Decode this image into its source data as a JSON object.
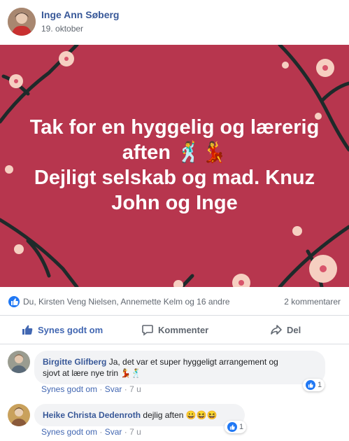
{
  "post": {
    "author": "Inge Ann Søberg",
    "date": "19. oktober",
    "banner_text_lines": [
      "Tak for en hyggelig og lærerig",
      "aften 🕺💃",
      "Dejligt selskab og mad. Knuz",
      "John og Inge"
    ],
    "banner_color": "#b7364e"
  },
  "stats": {
    "reactions_text": "Du, Kirsten Veng Nielsen, Annemette Kelm og 16 andre",
    "comments_text": "2 kommentarer"
  },
  "actions": {
    "like": "Synes godt om",
    "comment": "Kommenter",
    "share": "Del"
  },
  "comments": [
    {
      "name": "Birgitte Glifberg",
      "text": "Ja, det var et super hyggeligt arrangement og",
      "text2": "sjovt at lære nye trin 💃🕺",
      "like_label": "Synes godt om",
      "reply_label": "Svar",
      "age": "7 u",
      "likes": "1"
    },
    {
      "name": "Heike Christa Dedenroth",
      "text": "dejlig aften 😀😆😆",
      "like_label": "Synes godt om",
      "reply_label": "Svar",
      "age": "7 u",
      "likes": "1"
    }
  ],
  "colors": {
    "accent": "#4267b2",
    "name_link": "#385898",
    "like_blue": "#2078f4"
  }
}
